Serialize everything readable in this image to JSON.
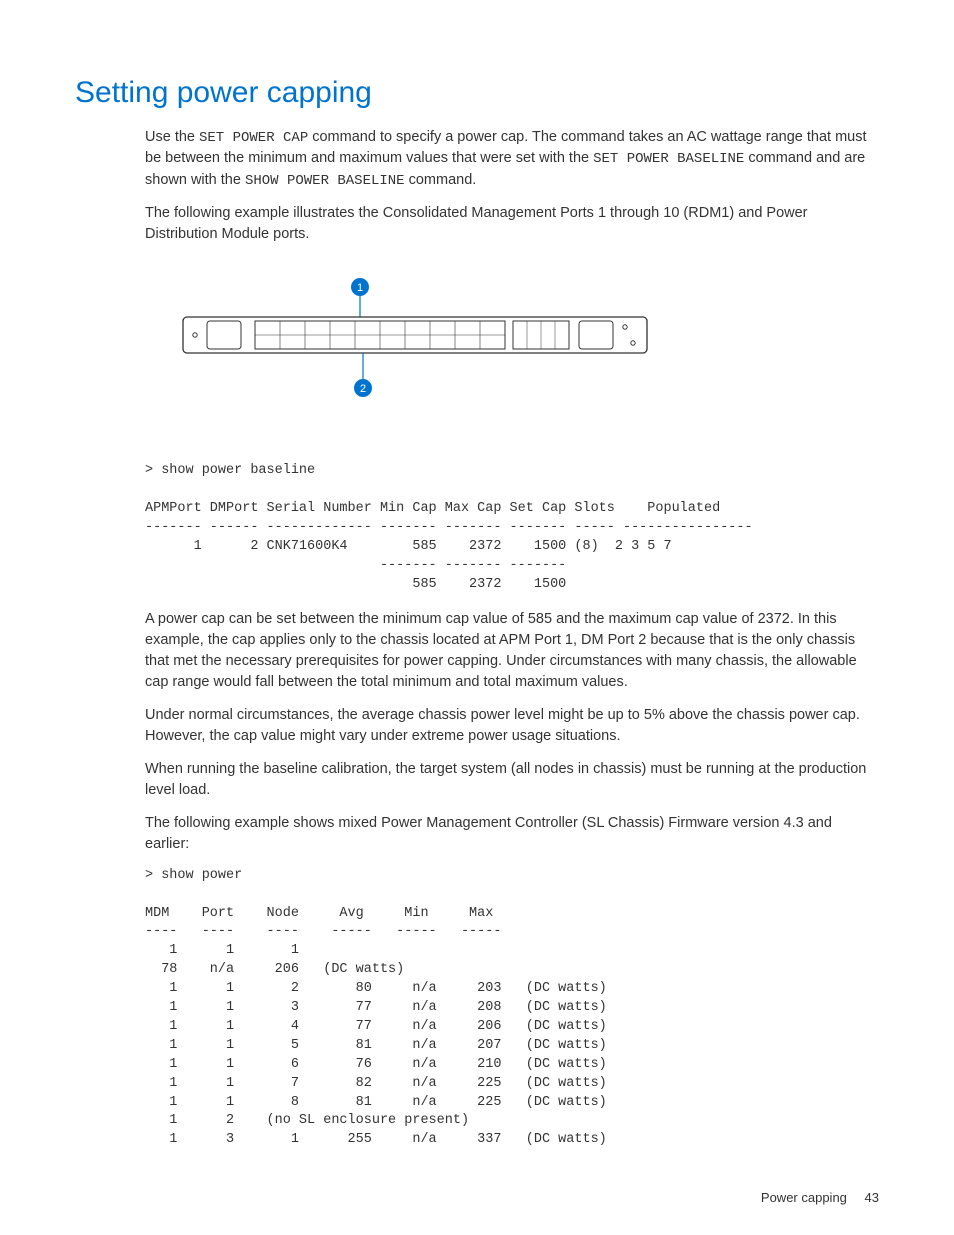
{
  "heading": "Setting power capping",
  "p1_a": "Use the ",
  "p1_cmd1": "SET POWER CAP",
  "p1_b": " command to specify a power cap. The command takes an AC wattage range that must be between the minimum and maximum values that were set with the ",
  "p1_cmd2": "SET POWER BASELINE",
  "p1_c": " command and are shown with the ",
  "p1_cmd3": "SHOW POWER BASELINE",
  "p1_d": " command.",
  "p2": "The following example illustrates the Consolidated Management Ports 1 through 10 (RDM1) and Power Distribution Module ports.",
  "cli1": "> show power baseline\n\nAPMPort DMPort Serial Number Min Cap Max Cap Set Cap Slots    Populated\n------- ------ ------------- ------- ------- ------- ----- ----------------\n      1      2 CNK71600K4        585    2372    1500 (8)  2 3 5 7\n                             ------- ------- -------\n                                 585    2372    1500",
  "p3": "A power cap can be set between the minimum cap value of 585 and the maximum cap value of 2372. In this example, the cap applies only to the chassis located at APM Port 1, DM Port 2 because that is the only chassis that met the necessary prerequisites for power capping. Under circumstances with many chassis, the allowable cap range would fall between the total minimum and total maximum values.",
  "p4": "Under normal circumstances, the average chassis power level might be up to 5% above the chassis power cap. However, the cap value might vary under extreme power usage situations.",
  "p5": "When running the baseline calibration, the target system (all nodes in chassis) must be running at the production level load.",
  "p6": "The following example shows mixed Power Management Controller (SL Chassis) Firmware version 4.3 and earlier:",
  "cli2": "> show power\n\nMDM    Port    Node     Avg     Min     Max\n----   ----    ----    -----   -----   -----\n   1      1       1\n  78    n/a     206   (DC watts)\n   1      1       2       80     n/a     203   (DC watts)\n   1      1       3       77     n/a     208   (DC watts)\n   1      1       4       77     n/a     206   (DC watts)\n   1      1       5       81     n/a     207   (DC watts)\n   1      1       6       76     n/a     210   (DC watts)\n   1      1       7       82     n/a     225   (DC watts)\n   1      1       8       81     n/a     225   (DC watts)\n   1      2    (no SL enclosure present)\n   1      3       1      255     n/a     337   (DC watts)",
  "footer_label": "Power capping",
  "footer_page": "43"
}
